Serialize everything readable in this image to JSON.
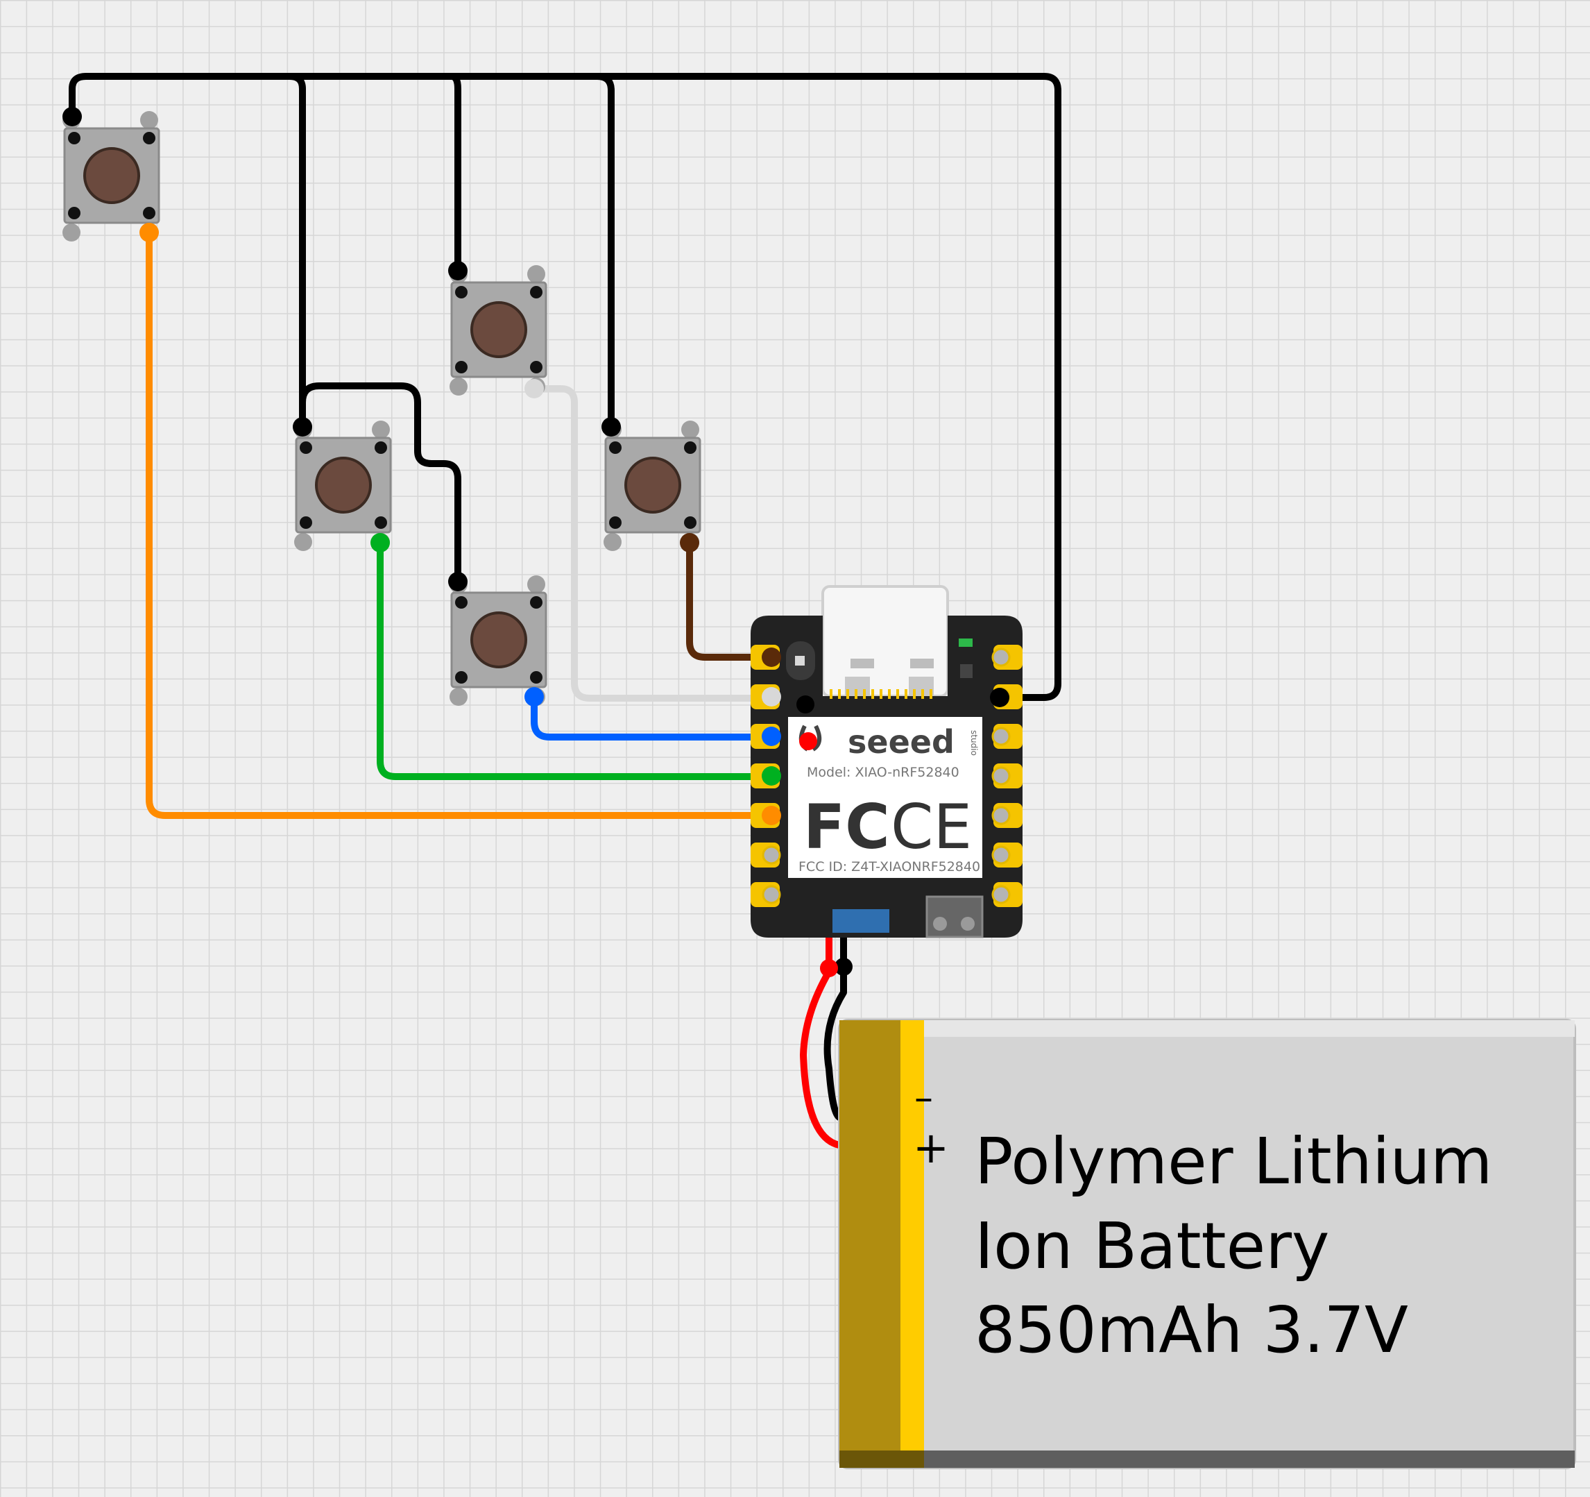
{
  "board": {
    "brand": "seeed",
    "brand_sub": "studio",
    "model_text": "Model: XIAO-nRF52840",
    "fcc_mark": "FC",
    "ce_mark": "CE",
    "fcc_id_text": "FCC ID: Z4T-XIAONRF52840"
  },
  "battery": {
    "minus_sign": "–",
    "plus_sign": "+",
    "label_line1": "Polymer Lithium",
    "label_line2": "Ion Battery",
    "label_line3": "850mAh 3.7V"
  },
  "colors": {
    "background": "#efefef",
    "grid_line": "#d6d6d6",
    "wire_black": "#000000",
    "wire_orange": "#ff8c00",
    "wire_green": "#00b020",
    "wire_blue": "#0060ff",
    "wire_white": "#d8d8d8",
    "wire_brown": "#5a2a0a",
    "wire_red": "#ff0000",
    "board_body": "#222222",
    "pad_gold": "#f5c400",
    "battery_body": "#d4d4d4",
    "battery_band": "#ffcc00",
    "button_cap": "#6b4a3e"
  }
}
